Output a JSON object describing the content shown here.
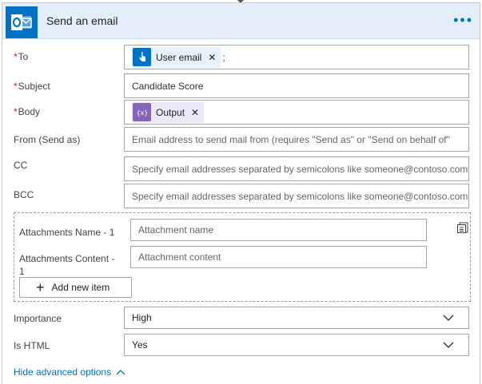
{
  "header": {
    "title": "Send an email",
    "icon": "outlook-icon",
    "accent": "#0072c6"
  },
  "fields": {
    "to": {
      "label": "To",
      "required": true,
      "token": "User email",
      "token_icon": "manual-trigger-icon",
      "separator": ";"
    },
    "subject": {
      "label": "Subject",
      "required": true,
      "value": "Candidate Score"
    },
    "body": {
      "label": "Body",
      "required": true,
      "token": "Output",
      "token_icon": "variable-icon"
    },
    "from": {
      "label": "From (Send as)",
      "placeholder": "Email address to send mail from (requires \"Send as\" or \"Send on behalf of\""
    },
    "cc": {
      "label": "CC",
      "placeholder": "Specify email addresses separated by semicolons like someone@contoso.com"
    },
    "bcc": {
      "label": "BCC",
      "placeholder": "Specify email addresses separated by semicolons like someone@contoso.com"
    }
  },
  "attachments": {
    "name_label": "Attachments Name - 1",
    "name_placeholder": "Attachment name",
    "content_label_line1": "Attachments Content -",
    "content_label_line2": "1",
    "content_placeholder": "Attachment content",
    "add_button": "Add new item"
  },
  "importance": {
    "label": "Importance",
    "value": "High"
  },
  "is_html": {
    "label": "Is HTML",
    "value": "Yes"
  },
  "footer": {
    "hide_advanced": "Hide advanced options"
  },
  "colors": {
    "required": "#e81123",
    "token_blue": "#0072c6",
    "token_purple": "#8764b8",
    "link": "#0072c6"
  }
}
